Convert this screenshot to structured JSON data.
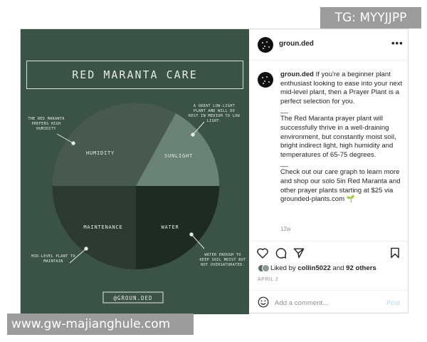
{
  "watermarks": {
    "top": "TG: MYYJJPP",
    "bottom": "www.gw-majianghule.com"
  },
  "image": {
    "title": "RED MARANTA CARE",
    "footer_handle": "@GROUN.DED",
    "segments": [
      {
        "label": "HUMIDITY",
        "note": [
          "THE RED MARANTA",
          "PREFERS HIGH",
          "HUMIDITY"
        ]
      },
      {
        "label": "SUNLIGHT",
        "note": [
          "A GREAT LOW-LIGHT",
          "PLANT AND WILL DO",
          "BEST IN MEDIUM TO LOW",
          "LIGHT."
        ]
      },
      {
        "label": "MAINTENANCE",
        "note": [
          "MID-LEVEL PLANT TO",
          "MAINTAIN"
        ]
      },
      {
        "label": "WATER",
        "note": [
          "WATER ENOUGH TO",
          "KEEP SOIL MOIST BUT",
          "NOT OVERSATURATED."
        ]
      }
    ],
    "colors": {
      "background": "#3b5247",
      "humidity": "#485a50",
      "sunlight": "#6a8278",
      "maintenance": "#2c3a33",
      "water": "#1e2a24"
    }
  },
  "header": {
    "username": "groun.ded",
    "more_icon": "more-horizontal-icon"
  },
  "caption": {
    "username": "groun.ded",
    "intro": " If you're a beginner plant enthusiast looking to ease into your next mid-level plant, then a Prayer Plant is a perfect selection for you.",
    "sep1": "__",
    "para2": "The Red Maranta prayer plant will successfully thrive in a well-draining environment, but constantly moist soil, bright indirect light, high humidity and temperatures of 65-75 degrees.",
    "sep2": "__",
    "para3": "Check out our care graph to learn more and shop our solo 5in Red Maranta and other prayer plants starting at $25 via grounded-plants.com 🌱",
    "time": "12w"
  },
  "actions": {
    "icons": [
      "heart-icon",
      "comment-icon",
      "share-icon",
      "bookmark-icon"
    ]
  },
  "likes": {
    "prefix": "Liked by ",
    "user": "collin5022",
    "middle": " and ",
    "others": "92 others"
  },
  "date": "APRIL 2",
  "comment": {
    "placeholder": "Add a comment...",
    "post_label": "Post",
    "emoji_icon": "smiley-icon"
  }
}
